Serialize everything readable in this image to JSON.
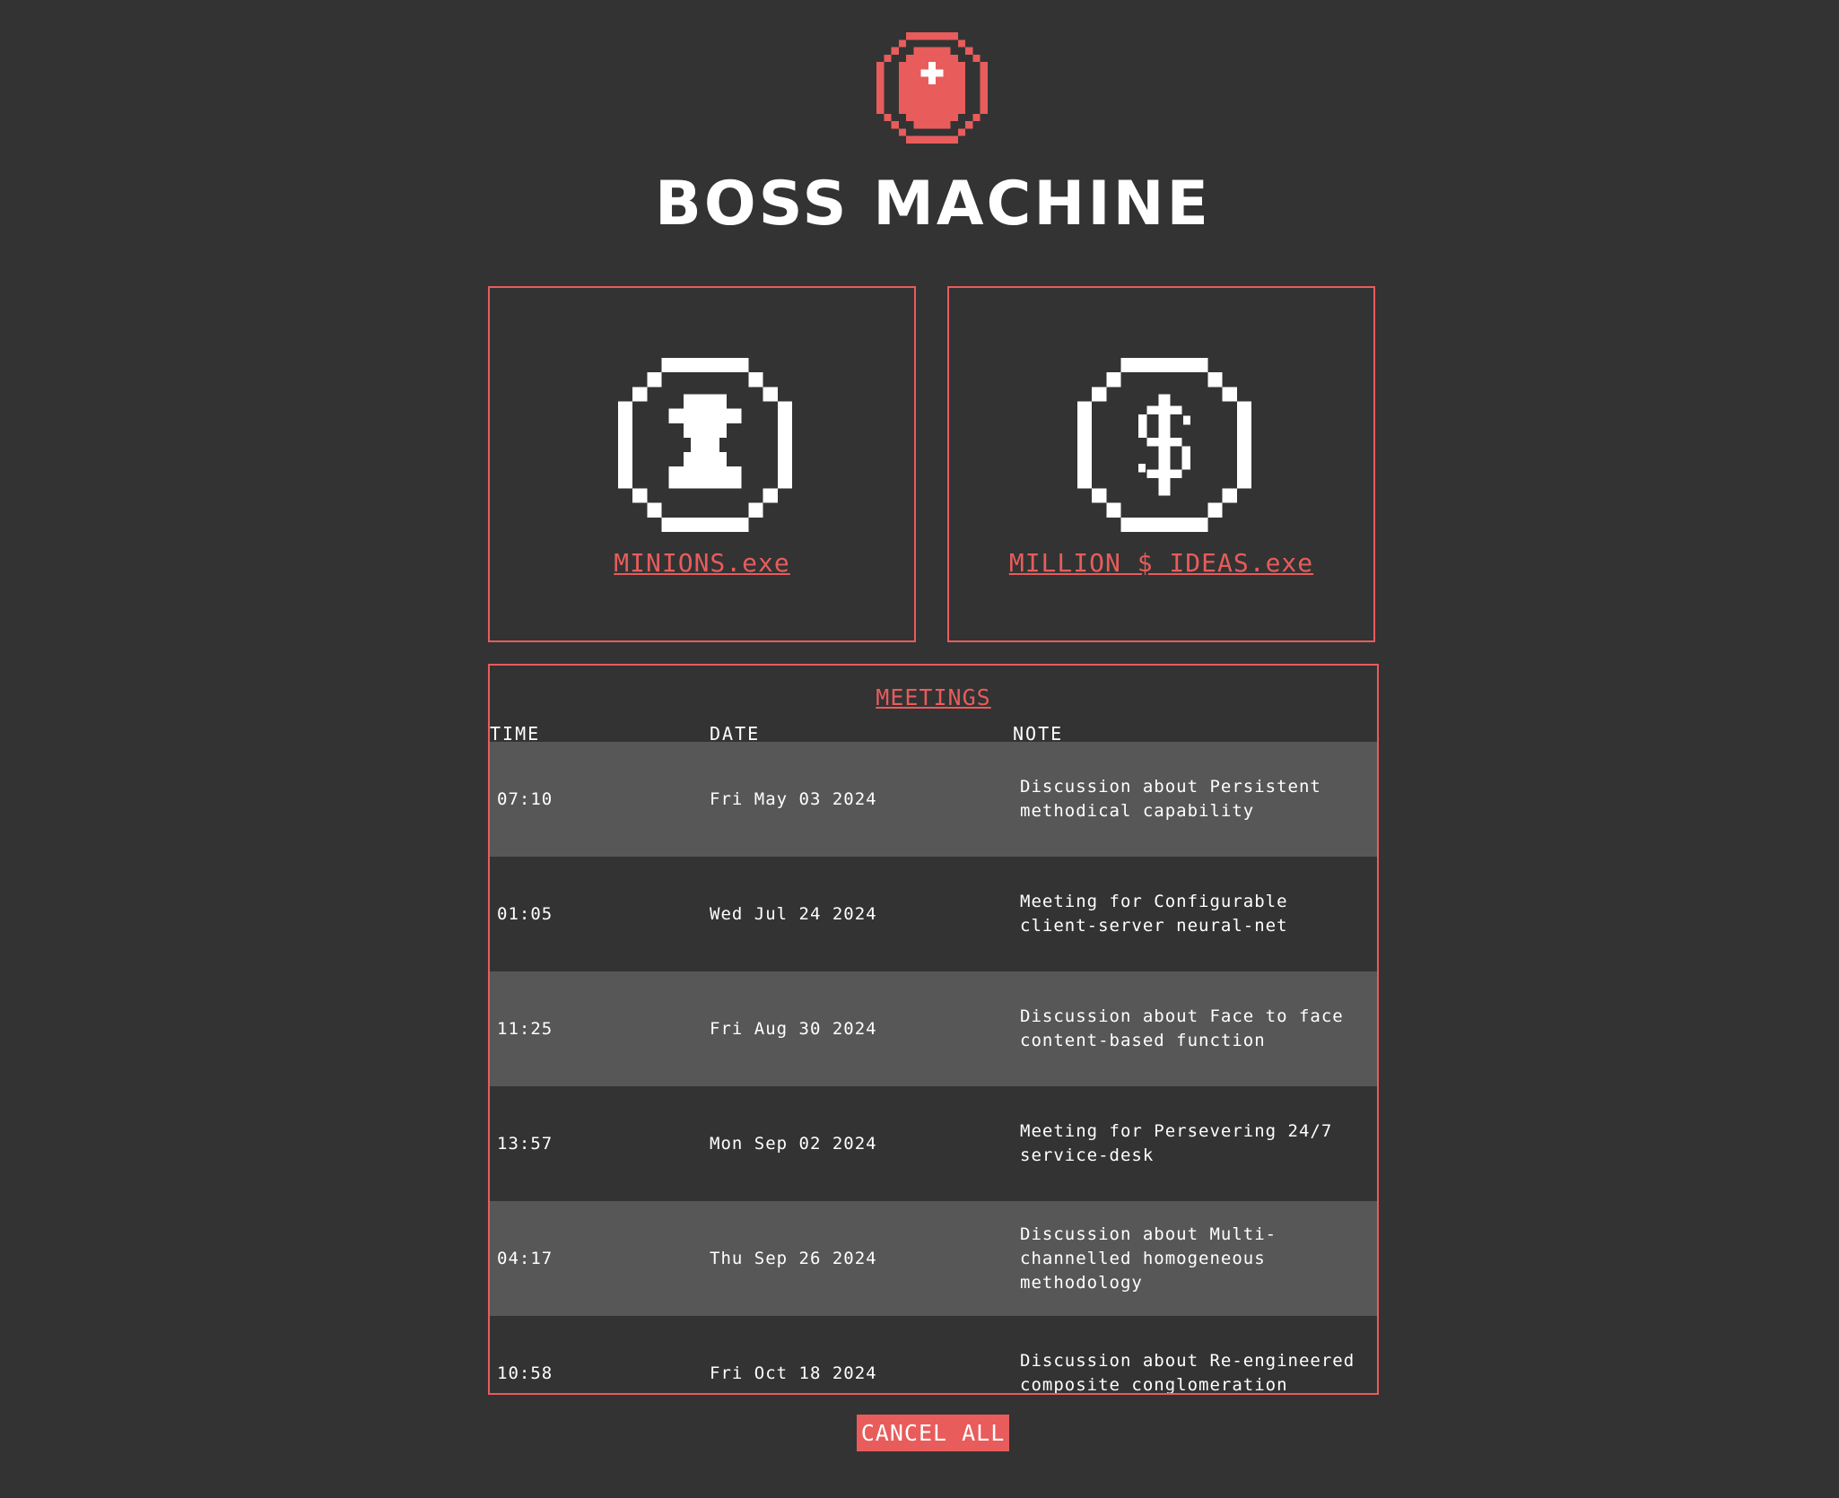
{
  "app": {
    "title": "BOSS MACHINE"
  },
  "colors": {
    "background": "#333333",
    "accent": "#e85c5c",
    "row_alt": "#575757",
    "text": "#ffffff"
  },
  "cards": {
    "minions": {
      "label": "MINIONS.exe",
      "icon": "minion-icon"
    },
    "ideas": {
      "label": "MILLION $ IDEAS.exe",
      "icon": "dollar-icon"
    }
  },
  "meetings": {
    "title": "MEETINGS",
    "columns": {
      "time": "TIME",
      "date": "DATE",
      "note": "NOTE"
    },
    "rows": [
      {
        "time": "07:10",
        "date": "Fri May 03 2024",
        "note": "Discussion about Persistent methodical capability"
      },
      {
        "time": "01:05",
        "date": "Wed Jul 24 2024",
        "note": "Meeting for Configurable client-server neural-net"
      },
      {
        "time": "11:25",
        "date": "Fri Aug 30 2024",
        "note": "Discussion about Face to face content-based function"
      },
      {
        "time": "13:57",
        "date": "Mon Sep 02 2024",
        "note": "Meeting for Persevering 24/7 service-desk"
      },
      {
        "time": "04:17",
        "date": "Thu Sep 26 2024",
        "note": "Discussion about Multi-channelled homogeneous methodology"
      },
      {
        "time": "10:58",
        "date": "Fri Oct 18 2024",
        "note": "Discussion about Re-engineered composite conglomeration"
      }
    ]
  },
  "actions": {
    "cancel_all": "CANCEL ALL"
  }
}
